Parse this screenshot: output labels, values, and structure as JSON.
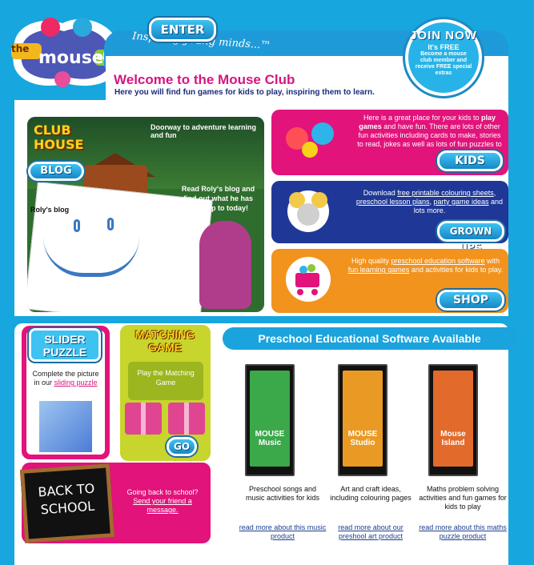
{
  "header": {
    "logo_text": "the mouse club",
    "tagline": "Inspiring young minds...™",
    "welcome_title": "Welcome to the Mouse Club",
    "welcome_subtitle": "Here you will find fun games for kids to play, inspiring them to learn."
  },
  "join_badge": {
    "title": "JOIN NOW",
    "free": "It's FREE",
    "body": "Become a mouse club member and receive FREE special extras"
  },
  "clubhouse": {
    "title_line1": "CLUB",
    "title_line2": "HOUSE",
    "doorway_text": "Doorway to adventure learning and fun",
    "enter_label": "ENTER",
    "blog_label": "Roly's blog",
    "blog_read_text": "Read Roly's blog and find out what he has been up to today!",
    "blog_button": "BLOG"
  },
  "kids_card": {
    "text_prefix": "Here is a great place for your kids to ",
    "text_bold": "play games",
    "text_suffix": " and have fun. There are lots of other fun activities including cards to make, stories to read, jokes as well as lots of fun puzzles to",
    "button": "KIDS"
  },
  "grown_card": {
    "text_prefix": "Download ",
    "link1": "free printable colouring sheets",
    "link2": "preschool lesson plans",
    "link3": "party game ideas",
    "text_suffix": " and lots more.",
    "button": "GROWN UPS"
  },
  "shop_card": {
    "text_prefix": "High quality ",
    "link1": "preschool education software",
    "text_mid": " with ",
    "link2": "fun learning games",
    "text_suffix": " and activities for kids to play.",
    "button": "SHOP"
  },
  "slider_puzzle": {
    "title": "SLIDER PUZZLE",
    "text": "Complete the picture in our ",
    "link": "sliding puzzle"
  },
  "matching_game": {
    "title": "MATCHING GAME",
    "text": "Play the Matching Game",
    "button": "GO"
  },
  "back_to_school": {
    "board_line1": "BACK TO",
    "board_line2": "SCHOOL",
    "text": "Going back to school? ",
    "link": "Send your friend a message."
  },
  "software": {
    "heading": "Preschool Educational Software Available",
    "products": [
      {
        "cover_title": "MOUSE Music",
        "desc": "Preschool songs and music activities for kids",
        "link": "read more about this music product",
        "color": "#3ba84a"
      },
      {
        "cover_title": "MOUSE Studio",
        "desc": "Art and craft ideas, including colouring pages",
        "link": "read more about our preshool art product",
        "color": "#e89a25"
      },
      {
        "cover_title": "Mouse Island",
        "desc": "Maths problem solving activities and fun games for kids to play",
        "link": "read more about this maths puzzle product",
        "color": "#e26a2a"
      }
    ]
  },
  "colors": {
    "background": "#17a6de",
    "pink": "#e2137b",
    "navy": "#1f3897",
    "orange": "#f2931e",
    "green_card": "#c7d52d",
    "title_pink": "#d6157f"
  }
}
